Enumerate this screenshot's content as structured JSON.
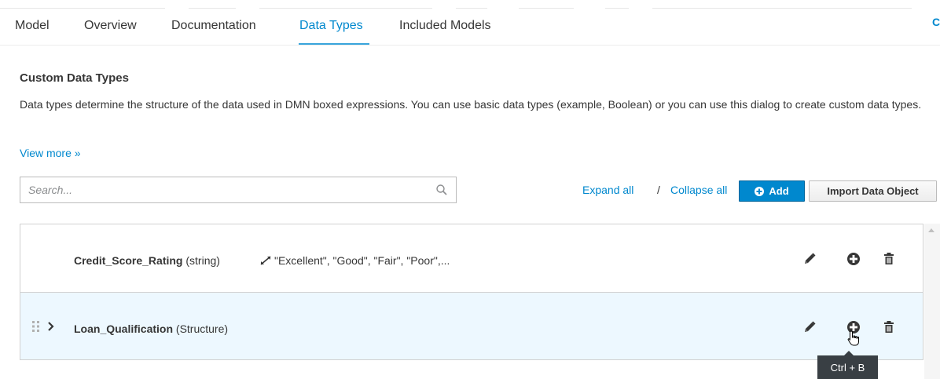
{
  "tabs": [
    {
      "label": "Model",
      "active": false
    },
    {
      "label": "Overview",
      "active": false
    },
    {
      "label": "Documentation",
      "active": false
    },
    {
      "label": "Data Types",
      "active": true
    },
    {
      "label": "Included Models",
      "active": false
    }
  ],
  "edge_glyph": "C",
  "section": {
    "title": "Custom Data Types",
    "description": "Data types determine the structure of the data used in DMN boxed expressions. You can use basic data types (example, Boolean) or you can use this dialog to create custom data types.",
    "view_more": "View more »"
  },
  "search": {
    "placeholder": "Search...",
    "value": ""
  },
  "toolbar": {
    "expand_all": "Expand all",
    "separator": "/",
    "collapse_all": "Collapse all",
    "add_label": "Add",
    "import_label": "Import Data Object"
  },
  "data_types": [
    {
      "name": "Credit_Score_Rating",
      "type": "(string)",
      "constraint": "\"Excellent\", \"Good\", \"Fair\", \"Poor\",..."
    },
    {
      "name": "Loan_Qualification",
      "type": "(Structure)"
    }
  ],
  "tooltip": {
    "text": "Ctrl + B"
  },
  "colors": {
    "primary_blue": "#0088ce",
    "row_selected_bg": "#edf8ff",
    "tooltip_bg": "#393f44",
    "text": "#363636"
  },
  "icons": {
    "edit": "pencil-icon",
    "add_child": "plus-circle-icon",
    "delete": "trash-icon",
    "search": "search-icon",
    "constraint": "constraint-icon",
    "drag": "drag-handle-icon",
    "expand": "chevron-right-icon"
  }
}
